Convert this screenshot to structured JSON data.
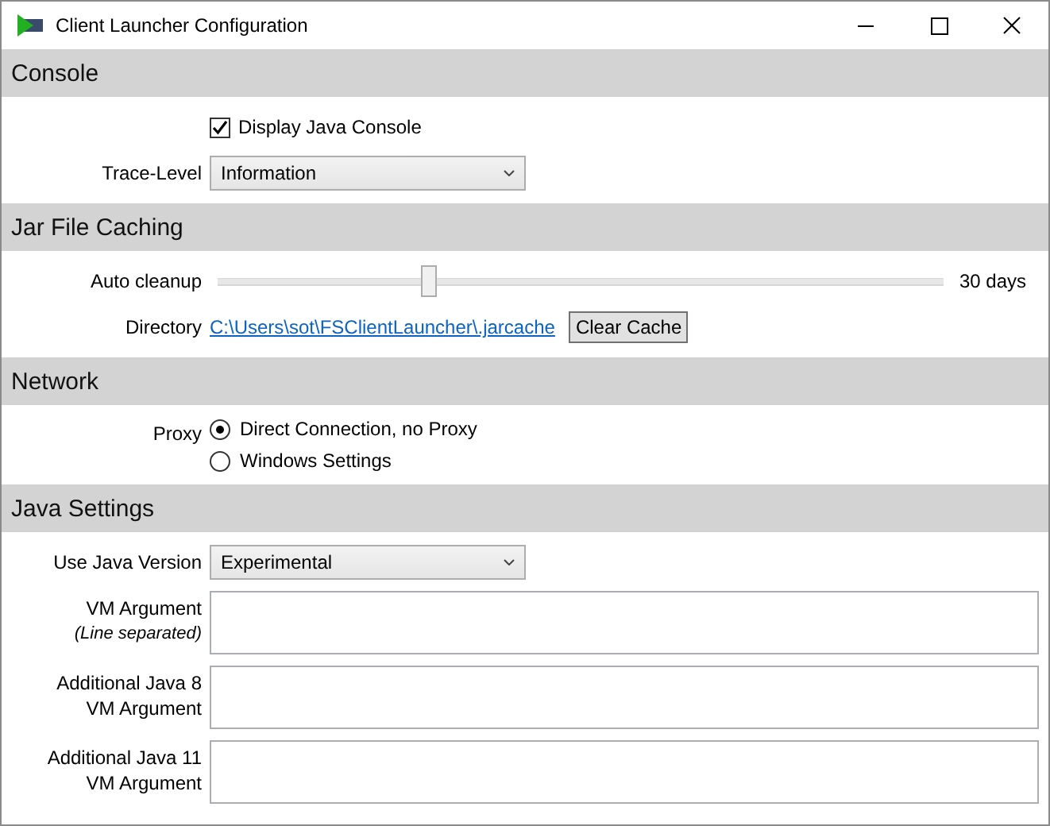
{
  "window": {
    "title": "Client Launcher Configuration"
  },
  "sections": [
    {
      "title": "Console",
      "rows": [
        {
          "kind": "checkbox",
          "label": "Display Java Console",
          "checked": true
        },
        {
          "kind": "dropdown",
          "label": "Trace-Level",
          "value": "Information"
        }
      ]
    },
    {
      "title": "Jar File Caching",
      "rows": [
        {
          "kind": "slider",
          "label": "Auto cleanup",
          "level": 0.29,
          "reading": "30 days"
        },
        {
          "kind": "link",
          "label": "Directory",
          "value": "C:\\Users\\sot\\FSClientLauncher\\.jarcache",
          "button": "Clear Cache"
        }
      ]
    },
    {
      "title": "Network",
      "rows": [
        {
          "kind": "radio",
          "label": "Proxy",
          "options": [
            {
              "label": "Direct Connection, no Proxy",
              "selected": true
            },
            {
              "label": "Windows Settings",
              "selected": false
            }
          ]
        }
      ]
    },
    {
      "title": "Java Settings",
      "rows": [
        {
          "kind": "dropdown",
          "label": "Use Java Version",
          "value": "Experimental"
        },
        {
          "kind": "textarea",
          "label": "VM Argument",
          "note": "(Line separated)"
        },
        {
          "kind": "textarea",
          "label": "Additional Java 8\nVM Argument"
        },
        {
          "kind": "textarea",
          "label": "Additional Java 11\nVM Argument"
        }
      ]
    }
  ]
}
